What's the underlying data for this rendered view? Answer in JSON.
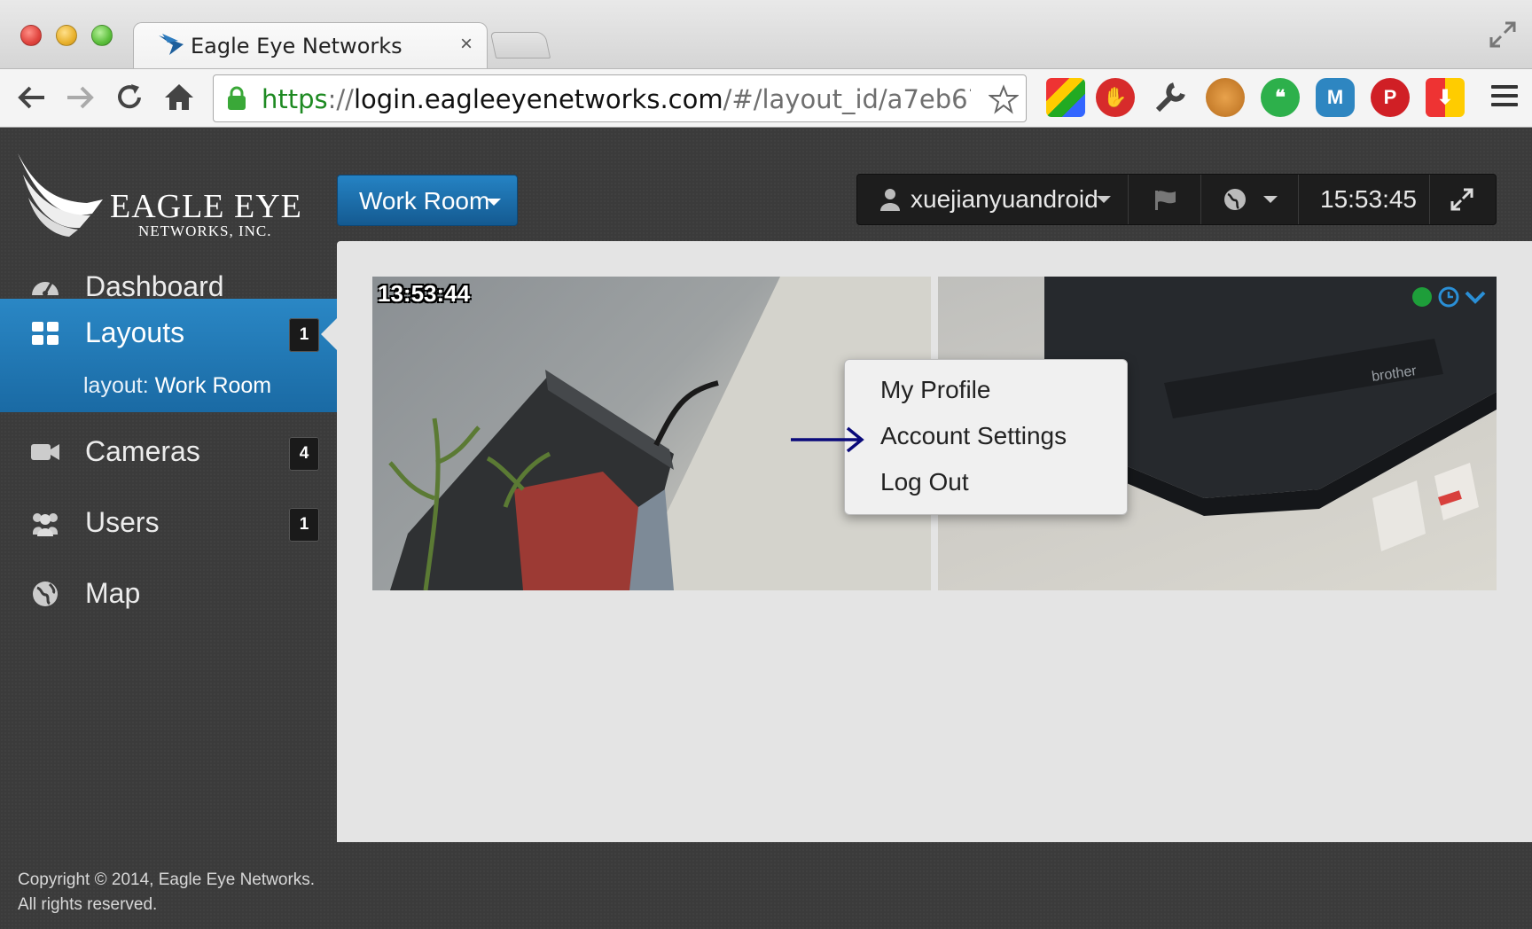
{
  "browser": {
    "tab_title": "Eagle Eye Networks",
    "tab_close": "×",
    "url_scheme": "https",
    "url_sep": "://",
    "url_host": "login.eagleeyenetworks.com",
    "url_path": "/#/layout_id/a7eb67..."
  },
  "app": {
    "logo_text": "EAGLE EYE",
    "logo_sub": "NETWORKS, INC.",
    "layout_button": "Work Room",
    "topbar": {
      "username": "xuejianyuandroid",
      "time": "15:53:45"
    },
    "user_menu": [
      "My Profile",
      "Account Settings",
      "Log Out"
    ],
    "sidebar": {
      "items": [
        {
          "label": "Dashboard",
          "icon": "dashboard-icon"
        },
        {
          "label": "Layouts",
          "icon": "grid-icon",
          "badge": "1"
        },
        {
          "label": "Cameras",
          "icon": "camera-icon",
          "badge": "4"
        },
        {
          "label": "Users",
          "icon": "users-icon",
          "badge": "1"
        },
        {
          "label": "Map",
          "icon": "globe-icon"
        }
      ],
      "layout_sub_prefix": "layout:",
      "layout_sub_name": "Work Room"
    },
    "cameras": [
      {
        "timestamp": "13:53:44"
      },
      {
        "timestamp": ""
      }
    ],
    "copyright_line1": "Copyright © 2014, Eagle Eye Networks.",
    "copyright_line2": "All rights reserved.",
    "colors": {
      "accent": "#1f77b8",
      "sidebar_bg": "#3b3b3b",
      "content_bg": "#e4e4e4",
      "status_online": "#1e9e3a"
    }
  }
}
